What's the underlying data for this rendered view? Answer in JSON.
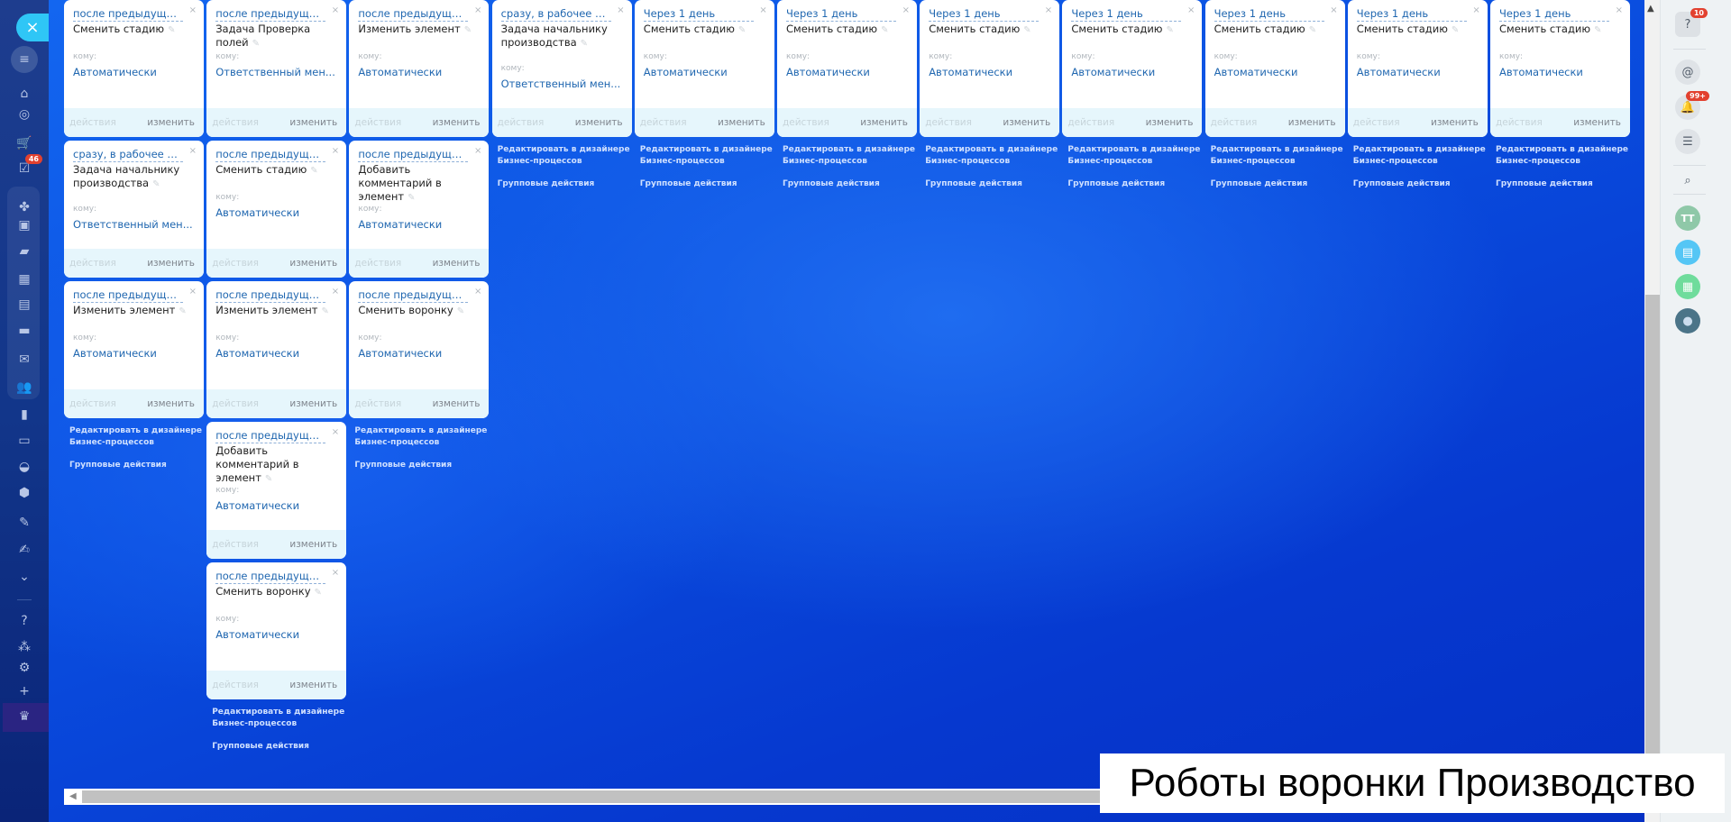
{
  "sidebar": {
    "close_icon": "×",
    "tasks_badge": "46",
    "icons": [
      "filter-icon",
      "home-icon",
      "target-icon",
      "cart-icon",
      "tasks-icon",
      "sites-icon",
      "forms-icon",
      "chat-icon",
      "calendar-icon",
      "document-icon",
      "storage-icon",
      "mail-icon",
      "people-icon",
      "chart-icon",
      "contact-card-icon",
      "robot-icon",
      "box-icon",
      "document-edit-icon",
      "signature-icon",
      "chevron-down-icon",
      "help-icon",
      "structure-icon",
      "gear-icon",
      "plus-icon",
      "crown-icon"
    ]
  },
  "card_labels": {
    "to": "кому:",
    "actions": "действия",
    "edit": "изменить",
    "close": "×",
    "pencil": "✎"
  },
  "links": {
    "designer": "Редактировать в дизайнере Бизнес-процессов",
    "group": "Групповые действия"
  },
  "columns": [
    {
      "cards": [
        {
          "when": "после предыдущего, п...",
          "title": "Сменить стадию",
          "to": "Автоматически"
        },
        {
          "when": "сразу, в рабочее врем...",
          "title": "Задача начальнику производства",
          "to": "Ответственный мен..."
        },
        {
          "when": "после предыдущего",
          "title": "Изменить элемент",
          "to": "Автоматически"
        }
      ]
    },
    {
      "cards": [
        {
          "when": "после предыдущего, п...",
          "title": "Задача Проверка полей",
          "to": "Ответственный мен..."
        },
        {
          "when": "после предыдущего, п...",
          "title": "Сменить стадию",
          "to": "Автоматически"
        },
        {
          "when": "после предыдущего",
          "title": "Изменить элемент",
          "to": "Автоматически"
        },
        {
          "when": "после предыдущего",
          "title": "Добавить комментарий в элемент",
          "to": "Автоматически"
        },
        {
          "when": "после предыдущего",
          "title": "Сменить воронку",
          "to": "Автоматически"
        }
      ]
    },
    {
      "cards": [
        {
          "when": "после предыдущего",
          "title": "Изменить элемент",
          "to": "Автоматически"
        },
        {
          "when": "после предыдущего",
          "title": "Добавить комментарий в элемент",
          "to": "Автоматически"
        },
        {
          "when": "после предыдущего",
          "title": "Сменить воронку",
          "to": "Автоматически"
        }
      ]
    },
    {
      "cards": [
        {
          "when": "сразу, в рабочее врем...",
          "title": "Задача начальнику производства",
          "to": "Ответственный мен..."
        }
      ]
    },
    {
      "cards": [
        {
          "when": "Через 1 день",
          "title": "Сменить стадию",
          "to": "Автоматически"
        }
      ]
    },
    {
      "cards": [
        {
          "when": "Через 1 день",
          "title": "Сменить стадию",
          "to": "Автоматически"
        }
      ]
    },
    {
      "cards": [
        {
          "when": "Через 1 день",
          "title": "Сменить стадию",
          "to": "Автоматически"
        }
      ]
    },
    {
      "cards": [
        {
          "when": "Через 1 день",
          "title": "Сменить стадию",
          "to": "Автоматически"
        }
      ]
    },
    {
      "cards": [
        {
          "when": "Через 1 день",
          "title": "Сменить стадию",
          "to": "Автоматически"
        }
      ]
    },
    {
      "cards": [
        {
          "when": "Через 1 день",
          "title": "Сменить стадию",
          "to": "Автоматически"
        }
      ]
    },
    {
      "cards": [
        {
          "when": "Через 1 день",
          "title": "Сменить стадию",
          "to": "Автоматически"
        }
      ]
    }
  ],
  "right_panel": {
    "help_badge": "10",
    "notifications_badge": "99+",
    "avatar_initials": "ТТ"
  },
  "caption": "Роботы воронки Производство"
}
